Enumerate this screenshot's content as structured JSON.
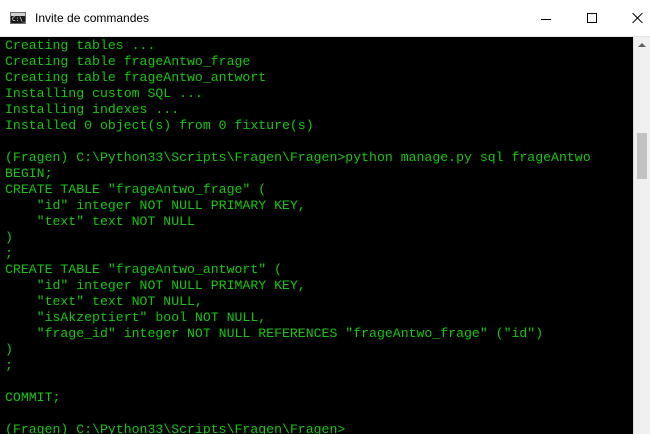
{
  "window": {
    "title": "Invite de commandes",
    "icon_label": "C:\\_",
    "icon_name": "console-app-icon",
    "colors": {
      "console_background": "#000000",
      "console_text": "#16c60c",
      "titlebar_background": "#ffffff",
      "scrollbar_track": "#f0f0f0",
      "scrollbar_thumb": "#c2c2c2"
    }
  },
  "console": {
    "lines": [
      "Creating tables ...",
      "Creating table frageAntwo_frage",
      "Creating table frageAntwo_antwort",
      "Installing custom SQL ...",
      "Installing indexes ...",
      "Installed 0 object(s) from 0 fixture(s)",
      "",
      "(Fragen) C:\\Python33\\Scripts\\Fragen\\Fragen>python manage.py sql frageAntwo",
      "BEGIN;",
      "CREATE TABLE \"frageAntwo_frage\" (",
      "    \"id\" integer NOT NULL PRIMARY KEY,",
      "    \"text\" text NOT NULL",
      ")",
      ";",
      "CREATE TABLE \"frageAntwo_antwort\" (",
      "    \"id\" integer NOT NULL PRIMARY KEY,",
      "    \"text\" text NOT NULL,",
      "    \"isAkzeptiert\" bool NOT NULL,",
      "    \"frage_id\" integer NOT NULL REFERENCES \"frageAntwo_frage\" (\"id\")",
      ")",
      ";",
      "",
      "COMMIT;",
      "",
      "(Fragen) C:\\Python33\\Scripts\\Fragen\\Fragen>"
    ]
  },
  "scrollbar": {
    "position_fraction": 0.27
  }
}
